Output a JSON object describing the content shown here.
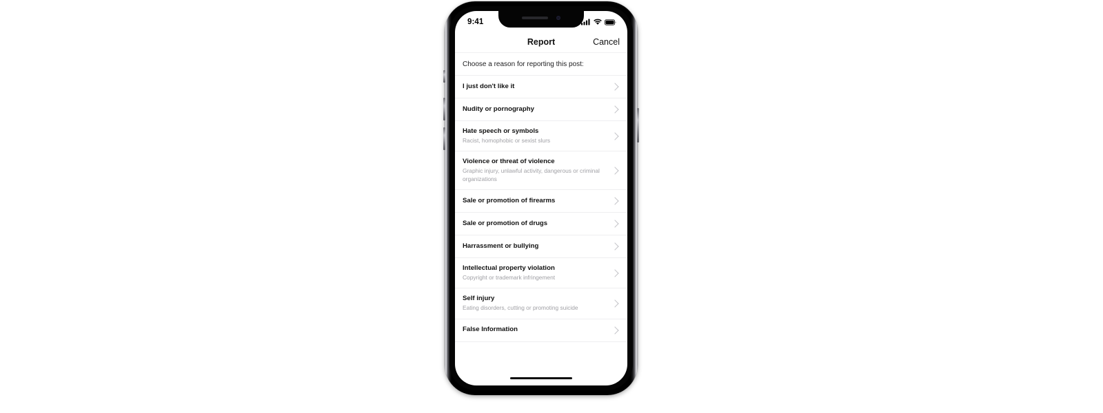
{
  "device": {
    "name": "iphone-x-mockup",
    "notch": {
      "speaker": "speaker-grille",
      "camera": "front-camera"
    }
  },
  "status_bar": {
    "time": "9:41",
    "icons": [
      "cellular-signal-icon",
      "wifi-icon",
      "battery-icon"
    ]
  },
  "nav": {
    "title": "Report",
    "cancel_label": "Cancel"
  },
  "prompt": {
    "text": "Choose a reason for reporting this post:"
  },
  "list": {
    "items": [
      {
        "title": "I just don't like it",
        "subtitle": ""
      },
      {
        "title": "Nudity or pornography",
        "subtitle": ""
      },
      {
        "title": "Hate speech or symbols",
        "subtitle": "Racist, homophobic or sexist slurs"
      },
      {
        "title": "Violence or threat of violence",
        "subtitle": "Graphic injury, unlawful activity, dangerous or criminal organizations"
      },
      {
        "title": "Sale or promotion of firearms",
        "subtitle": ""
      },
      {
        "title": "Sale or promotion of drugs",
        "subtitle": ""
      },
      {
        "title": "Harrassment or bullying",
        "subtitle": ""
      },
      {
        "title": "Intellectual property violation",
        "subtitle": "Copyright or trademark infringement"
      },
      {
        "title": "Self injury",
        "subtitle": "Eating disorders, cutting or promoting suicide"
      },
      {
        "title": "False Information",
        "subtitle": ""
      }
    ]
  },
  "colors": {
    "page_background": "#ffffff",
    "screen_background": "#ffffff",
    "title_text": "#111111",
    "subtitle_text": "#a0a0a5",
    "separator": "#eeeef0",
    "chevron": "#c2c2c7",
    "frame": "#000000"
  }
}
